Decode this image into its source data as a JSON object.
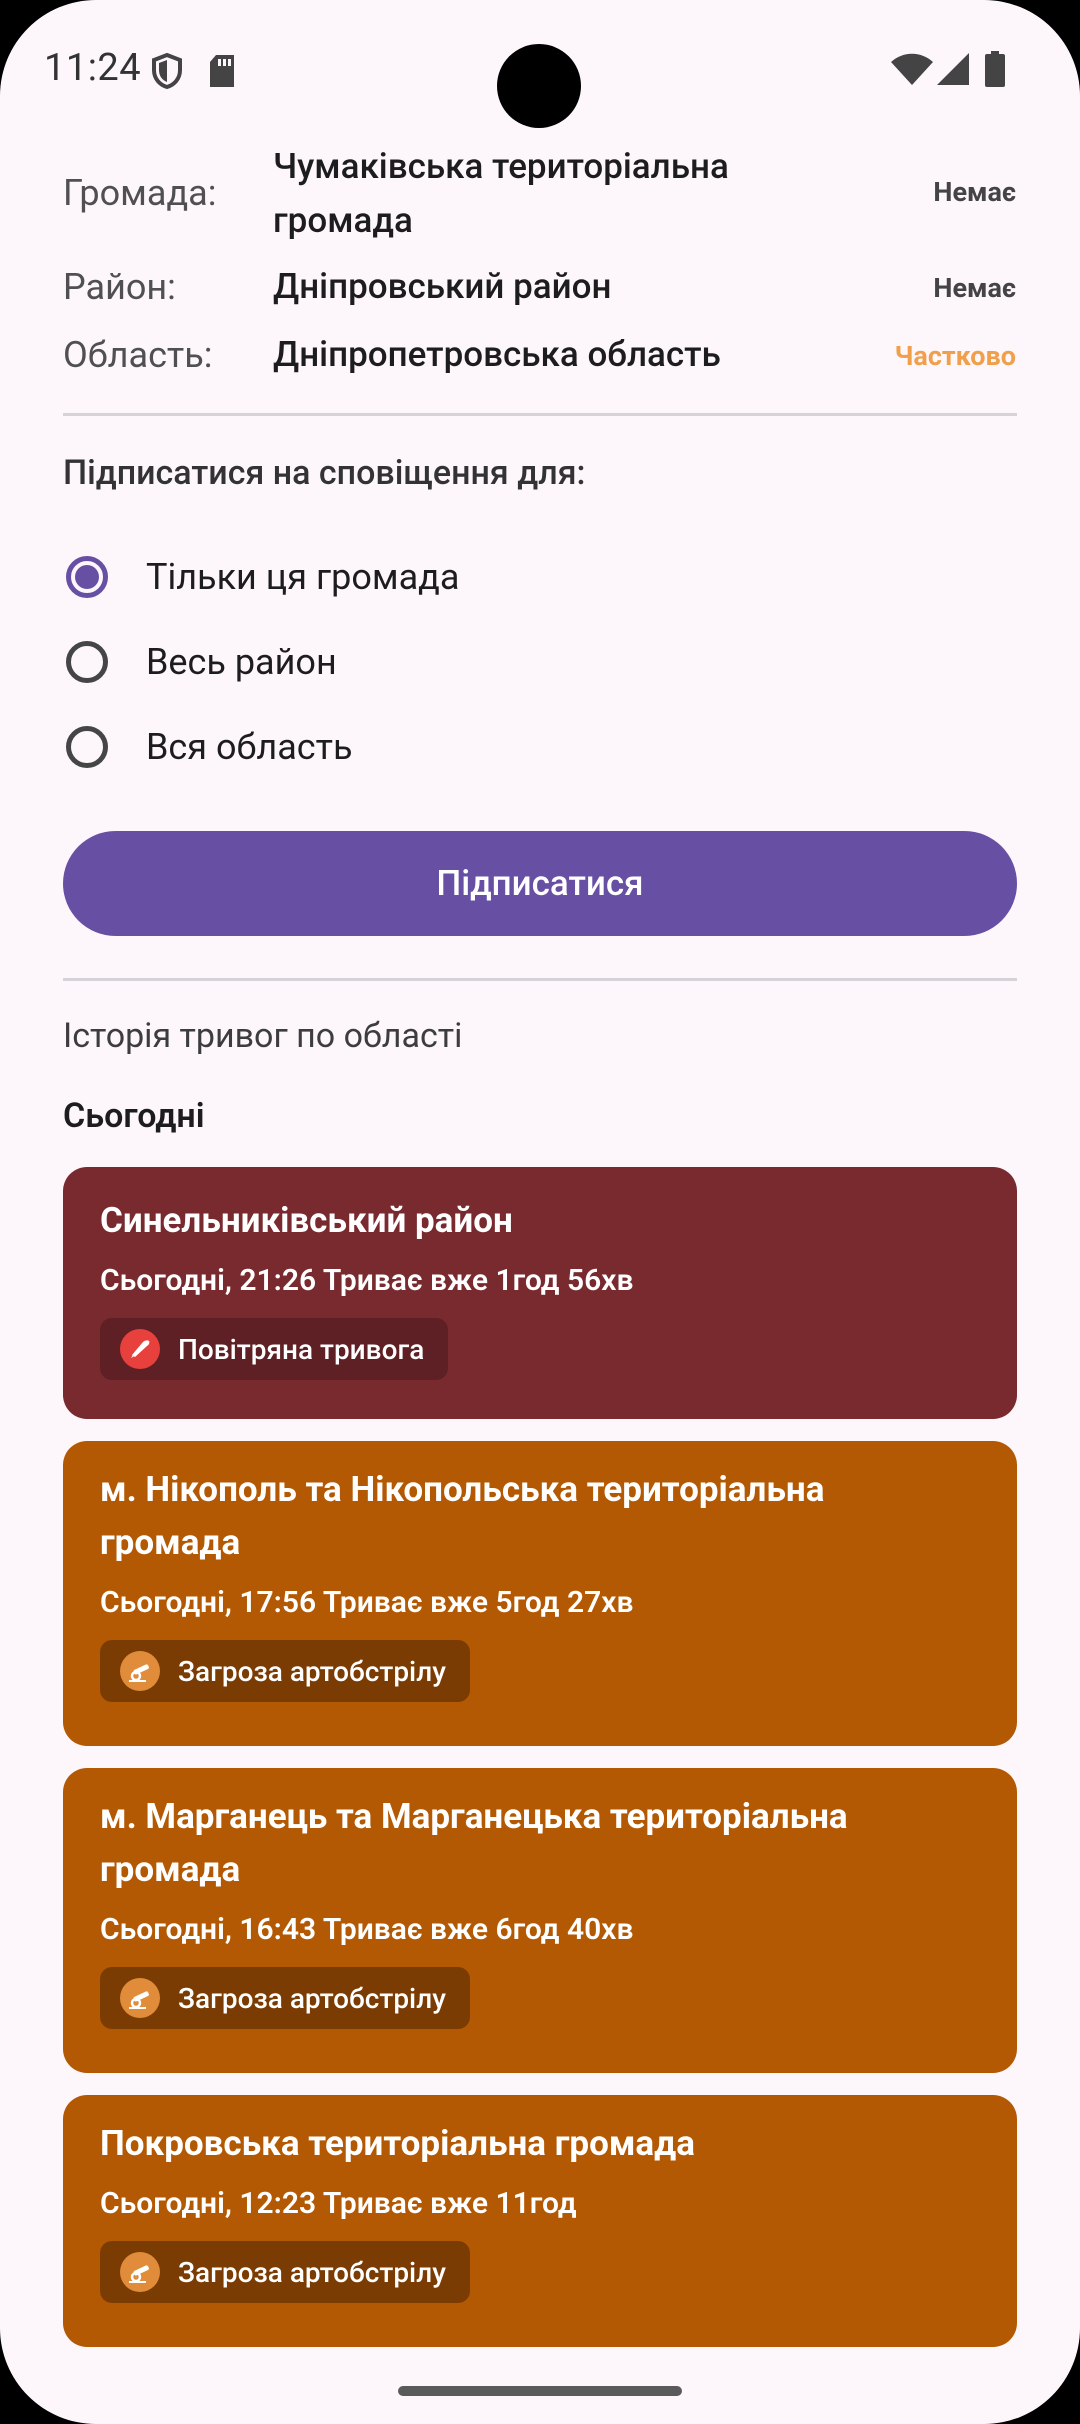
{
  "status_bar": {
    "time": "11:24"
  },
  "info": {
    "community": {
      "label": "Громада:",
      "value_line1": "Чумаківська територіальна",
      "value_line2": "громада",
      "status": "Немає"
    },
    "district": {
      "label": "Район:",
      "value": "Дніпровський район",
      "status": "Немає"
    },
    "region": {
      "label": "Область:",
      "value": "Дніпропетровська область",
      "status": "Частково"
    }
  },
  "subscribe": {
    "title": "Підписатися на сповіщення для:",
    "options": [
      "Тільки ця громада",
      "Весь район",
      "Вся область"
    ],
    "selected_index": 0,
    "button_label": "Підписатися"
  },
  "history": {
    "title": "Історія тривог по області",
    "day": "Сьогодні",
    "alerts": [
      {
        "title": "Синельниківський район",
        "time": "Сьогодні, 21:26 Триває вже 1год 56хв",
        "type": "Повітряна тривога",
        "icon": "rocket-icon"
      },
      {
        "title_line1": "м. Нікополь та Нікопольська територіальна",
        "title_line2": "громада",
        "time": "Сьогодні, 17:56 Триває вже 5год 27хв",
        "type": "Загроза артобстрілу",
        "icon": "artillery-icon"
      },
      {
        "title_line1": "м. Марганець та Марганецька територіальна",
        "title_line2": "громада",
        "time": "Сьогодні, 16:43 Триває вже 6год 40хв",
        "type": "Загроза артобстрілу",
        "icon": "artillery-icon"
      },
      {
        "title": "Покровська територіальна громада",
        "time": "Сьогодні, 12:23 Триває вже 11год",
        "type": "Загроза артобстрілу",
        "icon": "artillery-icon"
      }
    ]
  },
  "colors": {
    "accent": "#6750A4",
    "air_alert_card": "#782A2F",
    "artillery_card": "#B45903",
    "partial_status": "#F0A04B",
    "background": "#FDF7FC"
  }
}
